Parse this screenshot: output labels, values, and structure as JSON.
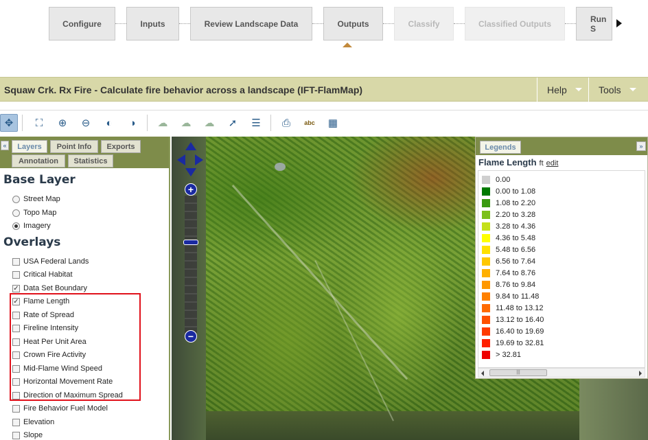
{
  "wizard": {
    "steps": [
      {
        "label": "Configure",
        "state": "normal"
      },
      {
        "label": "Inputs",
        "state": "normal"
      },
      {
        "label": "Review Landscape Data",
        "state": "normal"
      },
      {
        "label": "Outputs",
        "state": "current"
      },
      {
        "label": "Classify",
        "state": "disabled"
      },
      {
        "label": "Classified Outputs",
        "state": "disabled"
      },
      {
        "label": "Run S",
        "state": "normal"
      }
    ],
    "next_icon": "triangle-right-icon"
  },
  "titlebar": {
    "title": "Squaw Crk. Rx Fire - Calculate fire behavior across a landscape (IFT-FlamMap)",
    "help_label": "Help",
    "tools_label": "Tools"
  },
  "toolbar": {
    "icons": [
      "pan-icon",
      "zoom-full-extent-icon",
      "zoom-in-icon",
      "zoom-out-icon",
      "zoom-previous-icon",
      "zoom-next-icon",
      "draw-polygon-icon",
      "edit-polygon-icon",
      "polygon-attributes-icon",
      "identify-icon",
      "attribute-table-icon",
      "print-map-icon",
      "label-icon",
      "overview-map-icon"
    ]
  },
  "left_panel": {
    "tabs": [
      "Layers",
      "Point Info",
      "Exports",
      "Annotation",
      "Statistics"
    ],
    "active_tab": "Layers",
    "base_layer_heading": "Base Layer",
    "base_layers": [
      {
        "label": "Street Map",
        "selected": false
      },
      {
        "label": "Topo Map",
        "selected": false
      },
      {
        "label": "Imagery",
        "selected": true
      }
    ],
    "overlays_heading": "Overlays",
    "overlays": [
      {
        "label": "USA Federal Lands",
        "checked": false
      },
      {
        "label": "Critical Habitat",
        "checked": false
      },
      {
        "label": "Data Set Boundary",
        "checked": true
      },
      {
        "label": "Flame Length",
        "checked": true
      },
      {
        "label": "Rate of Spread",
        "checked": false
      },
      {
        "label": "Fireline Intensity",
        "checked": false
      },
      {
        "label": "Heat Per Unit Area",
        "checked": false
      },
      {
        "label": "Crown Fire Activity",
        "checked": false
      },
      {
        "label": "Mid-Flame Wind Speed",
        "checked": false
      },
      {
        "label": "Horizontal Movement Rate",
        "checked": false
      },
      {
        "label": "Direction of Maximum Spread",
        "checked": false
      },
      {
        "label": "Fire Behavior Fuel Model",
        "checked": false
      },
      {
        "label": "Elevation",
        "checked": false
      },
      {
        "label": "Slope",
        "checked": false
      }
    ],
    "collapse_icon": "double-chevron-left-icon",
    "highlight_color": "#e0101a"
  },
  "map": {
    "zoom_in_label": "+",
    "zoom_out_label": "−",
    "pan_icon": "pan-arrows-icon"
  },
  "legend": {
    "tab_label": "Legends",
    "layer_title": "Flame Length",
    "unit": "ft",
    "edit_label": "edit",
    "collapse_icon": "double-chevron-right-icon",
    "classes": [
      {
        "label": "0.00",
        "color": "#cfcfcf"
      },
      {
        "label": "0.00 to 1.08",
        "color": "#007a00"
      },
      {
        "label": "1.08 to 2.20",
        "color": "#3a9a10"
      },
      {
        "label": "2.20 to 3.28",
        "color": "#7cc01a"
      },
      {
        "label": "3.28 to 4.36",
        "color": "#c4e01a"
      },
      {
        "label": "4.36 to 5.48",
        "color": "#ffff00"
      },
      {
        "label": "5.48 to 6.56",
        "color": "#ffe000"
      },
      {
        "label": "6.56 to 7.64",
        "color": "#ffc800"
      },
      {
        "label": "7.64 to 8.76",
        "color": "#ffb000"
      },
      {
        "label": "8.76 to 9.84",
        "color": "#ff9800"
      },
      {
        "label": "9.84 to 11.48",
        "color": "#ff8000"
      },
      {
        "label": "11.48 to 13.12",
        "color": "#ff6a00"
      },
      {
        "label": "13.12 to 16.40",
        "color": "#ff5000"
      },
      {
        "label": "16.40 to 19.69",
        "color": "#ff3a00"
      },
      {
        "label": "19.69 to 32.81",
        "color": "#ff2000"
      },
      {
        "label": "> 32.81",
        "color": "#ee0000"
      }
    ]
  }
}
